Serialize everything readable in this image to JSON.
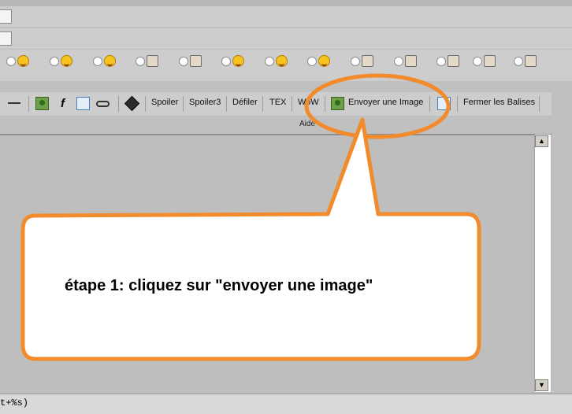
{
  "toolbar": {
    "spoiler": "Spoiler",
    "spoiler3": "Spoiler3",
    "defiler": "Défiler",
    "tex": "TEX",
    "wow": "WoW",
    "send_image": "Envoyer une Image",
    "close_tags": "Fermer les Balises",
    "help": "Aide"
  },
  "status_text": "t+%s)",
  "annotation": {
    "text": "étape 1: cliquez sur \"envoyer une image\"",
    "fill_color": "#ffffff",
    "stroke_color": "#f28b2c"
  },
  "smileys": [
    "grin",
    "surprised",
    "happy",
    "thumb-down",
    "thumb-up",
    "angry",
    "laugh",
    "smile",
    "book",
    "swords",
    "bomb",
    "scroll",
    "keyboard"
  ],
  "colors": {
    "accent": "#f28b2c",
    "panel": "#cdcdcd",
    "editor": "#bebebe"
  }
}
